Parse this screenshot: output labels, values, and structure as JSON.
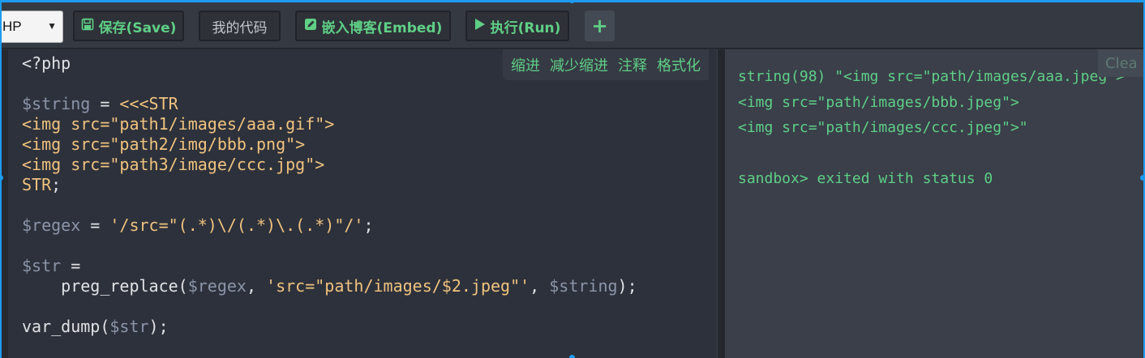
{
  "toolbar": {
    "language": "HP",
    "save": "保存(Save)",
    "my_code": "我的代码",
    "embed": "嵌入博客(Embed)",
    "run": "执行(Run)",
    "add": "+"
  },
  "editor_tools": [
    "缩进",
    "减少缩进",
    "注释",
    "格式化"
  ],
  "code_lines": [
    [
      {
        "t": "<?php",
        "c": "plain"
      }
    ],
    [],
    [
      {
        "t": "$string",
        "c": "v"
      },
      {
        "t": " = ",
        "c": "plain"
      },
      {
        "t": "<<<STR",
        "c": "str"
      }
    ],
    [
      {
        "t": "<img src=\"path1/images/aaa.gif\">",
        "c": "str"
      }
    ],
    [
      {
        "t": "<img src=\"path2/img/bbb.png\">",
        "c": "str"
      }
    ],
    [
      {
        "t": "<img src=\"path3/image/ccc.jpg\">",
        "c": "str"
      }
    ],
    [
      {
        "t": "STR",
        "c": "str"
      },
      {
        "t": ";",
        "c": "plain"
      }
    ],
    [],
    [
      {
        "t": "$regex",
        "c": "v"
      },
      {
        "t": " = ",
        "c": "plain"
      },
      {
        "t": "'/src=\"(.*)\\/(.*)\\.(.*)\"/'",
        "c": "str"
      },
      {
        "t": ";",
        "c": "plain"
      }
    ],
    [],
    [
      {
        "t": "$str",
        "c": "v"
      },
      {
        "t": " =",
        "c": "plain"
      }
    ],
    [
      {
        "t": "    preg_replace(",
        "c": "plain"
      },
      {
        "t": "$regex",
        "c": "v"
      },
      {
        "t": ", ",
        "c": "plain"
      },
      {
        "t": "'src=\"path/images/$2.jpeg\"'",
        "c": "str"
      },
      {
        "t": ", ",
        "c": "plain"
      },
      {
        "t": "$string",
        "c": "v"
      },
      {
        "t": ");",
        "c": "plain"
      }
    ],
    [],
    [
      {
        "t": "var_dump(",
        "c": "plain"
      },
      {
        "t": "$str",
        "c": "v"
      },
      {
        "t": ");",
        "c": "plain"
      }
    ]
  ],
  "output": {
    "clear_label": "Clea",
    "lines": [
      "string(98) \"<img src=\"path/images/aaa.jpeg\">",
      "<img src=\"path/images/bbb.jpeg\">",
      "<img src=\"path/images/ccc.jpeg\">\"",
      "",
      "sandbox> exited with status 0"
    ]
  },
  "colors": {
    "accent_green": "#5fcf86",
    "variable": "#8b95a8",
    "string": "#f0c37f",
    "selection_frame": "#1d9bf0"
  }
}
